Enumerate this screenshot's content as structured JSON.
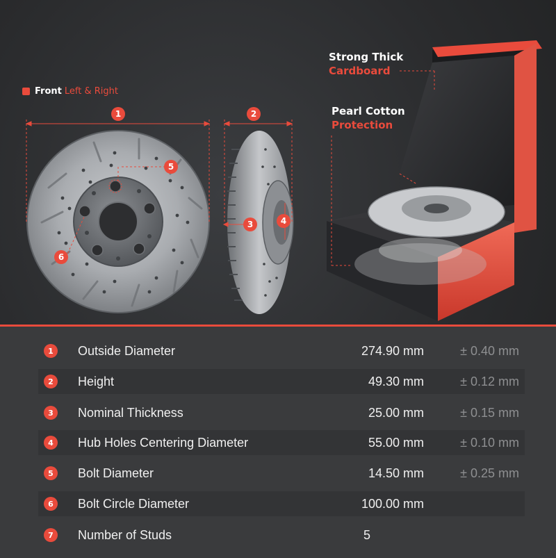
{
  "legend": {
    "title": "Front",
    "subtitle": "Left & Right"
  },
  "callouts": {
    "box_line1": "Strong Thick",
    "box_line2": "Cardboard",
    "foam_line1": "Pearl Cotton",
    "foam_line2": "Protection"
  },
  "diagram_markers": [
    "1",
    "2",
    "3",
    "4",
    "5",
    "6"
  ],
  "specs": [
    {
      "num": "1",
      "label": "Outside Diameter",
      "value": "274.90 mm",
      "tolerance": "± 0.40 mm"
    },
    {
      "num": "2",
      "label": "Height",
      "value": "49.30 mm",
      "tolerance": "± 0.12 mm"
    },
    {
      "num": "3",
      "label": "Nominal Thickness",
      "value": "25.00 mm",
      "tolerance": "± 0.15 mm"
    },
    {
      "num": "4",
      "label": "Hub Holes Centering Diameter",
      "value": "55.00 mm",
      "tolerance": "± 0.10 mm"
    },
    {
      "num": "5",
      "label": "Bolt Diameter",
      "value": "14.50 mm",
      "tolerance": "± 0.25 mm"
    },
    {
      "num": "6",
      "label": "Bolt Circle Diameter",
      "value": "100.00 mm",
      "tolerance": ""
    },
    {
      "num": "7",
      "label": "Number of Studs",
      "value": "5",
      "tolerance": ""
    }
  ],
  "colors": {
    "accent": "#e94b3c",
    "panel": "#3a3b3d",
    "background": "#2a2b2d"
  }
}
